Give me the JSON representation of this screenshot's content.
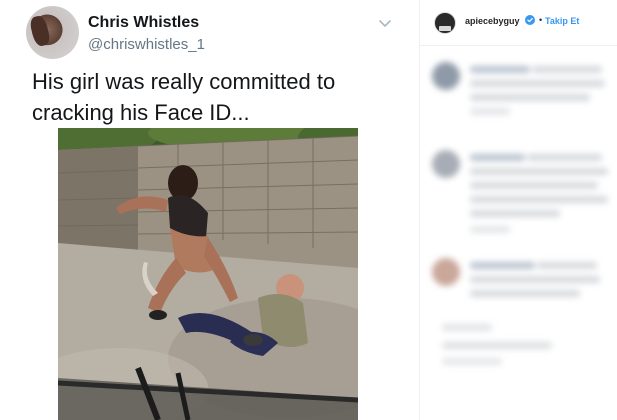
{
  "post": {
    "tweet": {
      "author_name": "Chris Whistles",
      "author_handle": "@chriswhistles_1",
      "text": "His girl was really committed to cracking his Face ID..."
    }
  },
  "sidebar": {
    "username": "apiecebyguy",
    "separator": "•",
    "follow_label": "Takip Et"
  },
  "colors": {
    "link_blue": "#3897f0",
    "verified_blue": "#3897f0",
    "text_dark": "#14171a",
    "handle_gray": "#657786"
  },
  "icons": [
    "chevron-down-icon",
    "verified-badge-icon"
  ]
}
